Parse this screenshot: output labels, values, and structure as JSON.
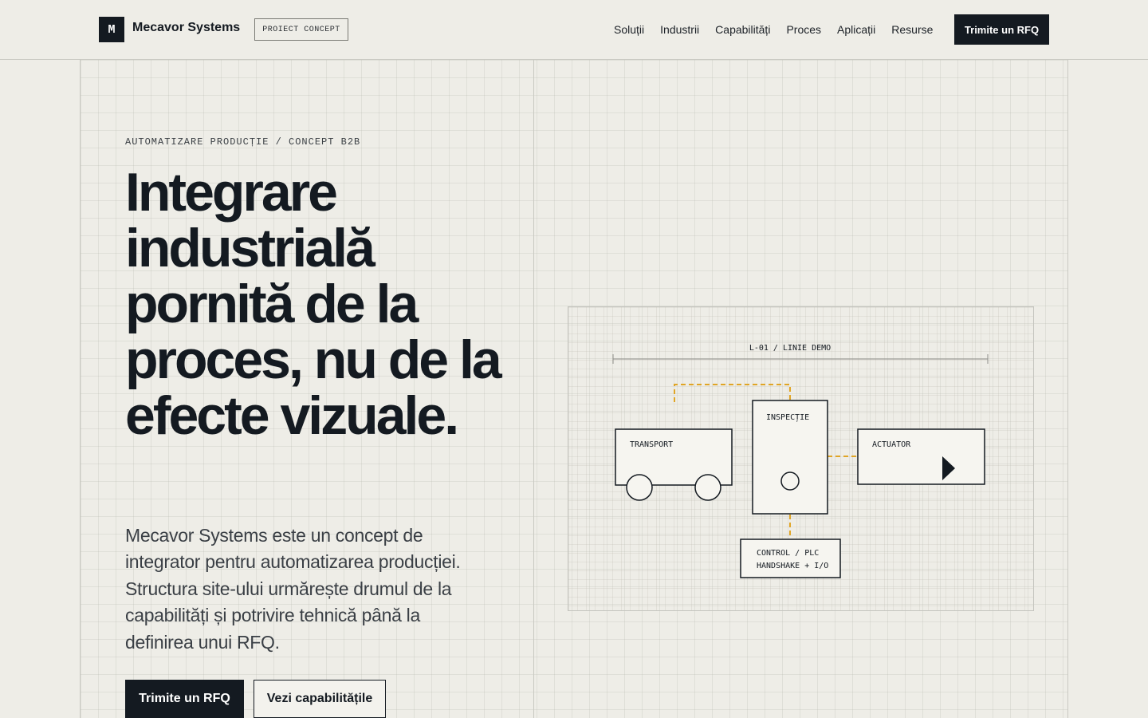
{
  "header": {
    "logo_letter": "M",
    "brand": "Mecavor Systems",
    "badge": "PROIECT CONCEPT",
    "nav": [
      "Soluții",
      "Industrii",
      "Capabilități",
      "Proces",
      "Aplicații",
      "Resurse"
    ],
    "cta": "Trimite un RFQ"
  },
  "hero": {
    "eyebrow": "AUTOMATIZARE PRODUCȚIE / CONCEPT B2B",
    "headline": "Integrare industrială pornită de la proces, nu de la efecte vizuale.",
    "lead": "Mecavor Systems este un concept de integrator pentru automatizarea producției. Structura site-ului urmărește drumul de la capabilități și potrivire tehnică până la definirea unui RFQ.",
    "primary_button": "Trimite un RFQ",
    "secondary_button": "Vezi capabilitățile"
  },
  "diagram": {
    "line_label": "L-01 / LINIE DEMO",
    "transport": "TRANSPORT",
    "inspection": "INSPECȚIE",
    "actuator": "ACTUATOR",
    "control_line1": "CONTROL / PLC",
    "control_line2": "HANDSHAKE + I/O",
    "colors": {
      "ink": "#141a21",
      "signal": "#e0a526",
      "box_fill": "#f6f5f0"
    }
  }
}
